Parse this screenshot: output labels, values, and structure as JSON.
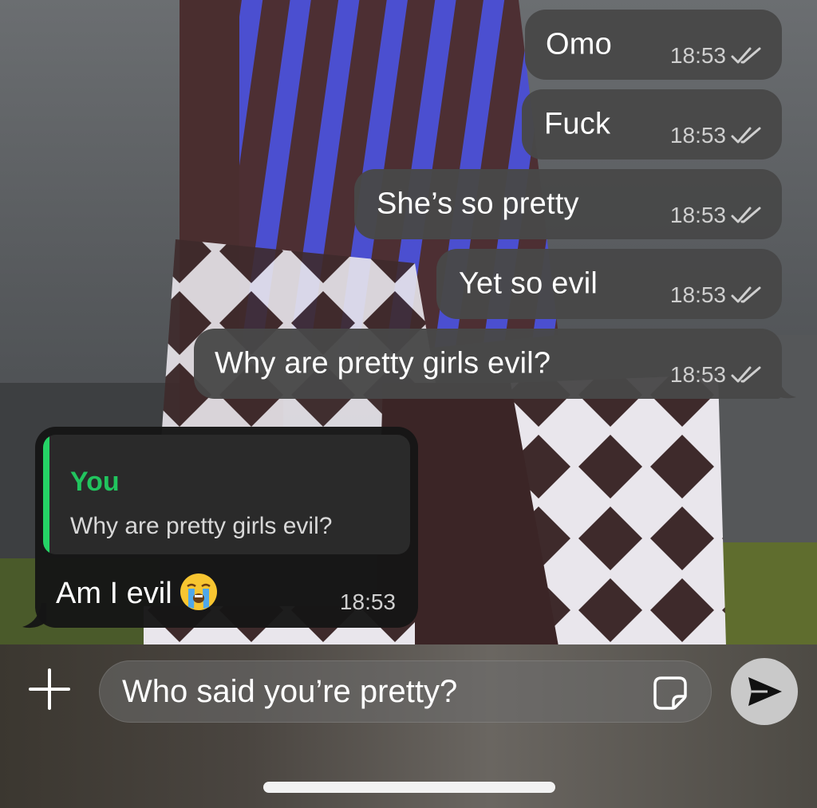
{
  "messages_out": [
    {
      "text": "Omo",
      "time": "18:53"
    },
    {
      "text": "Fuck",
      "time": "18:53"
    },
    {
      "text": "She’s so pretty",
      "time": "18:53"
    },
    {
      "text": "Yet so evil",
      "time": "18:53"
    },
    {
      "text": "Why are pretty girls evil?",
      "time": "18:53"
    }
  ],
  "reply": {
    "quote_author": "You",
    "quote_text": "Why are pretty girls evil?",
    "text": "Am I evil",
    "emoji": "loudly-crying-face",
    "time": "18:53"
  },
  "composer": {
    "input_value": "Who said you’re pretty?"
  },
  "colors": {
    "outgoing_bubble": "#484848",
    "incoming_bubble": "#161616",
    "quote_accent": "#25d366"
  }
}
